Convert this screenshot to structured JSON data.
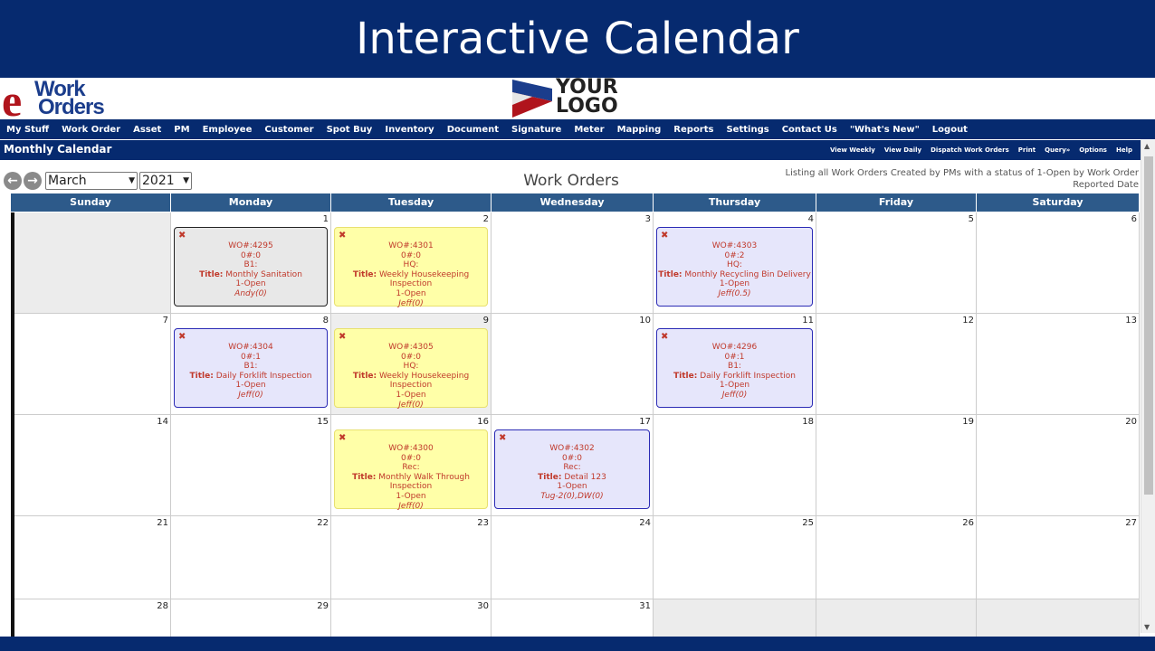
{
  "banner": {
    "title": "Interactive Calendar"
  },
  "brand": {
    "e": "e",
    "work": "Work",
    "orders": "Orders"
  },
  "placeholder_logo": {
    "line1": "YOUR",
    "line2": "LOGO"
  },
  "menu": [
    "My Stuff",
    "Work Order",
    "Asset",
    "PM",
    "Employee",
    "Customer",
    "Spot Buy",
    "Inventory",
    "Document",
    "Signature",
    "Meter",
    "Mapping",
    "Reports",
    "Settings",
    "Contact Us",
    "\"What's New\"",
    "Logout"
  ],
  "subbar": {
    "title": "Monthly Calendar",
    "links": [
      "View Weekly",
      "View Daily",
      "Dispatch Work Orders",
      "Print",
      "Query»",
      "Options",
      "Help"
    ]
  },
  "nav": {
    "month": "March",
    "year": "2021",
    "prev_glyph": "←",
    "next_glyph": "→"
  },
  "calendar": {
    "title": "Work Orders",
    "listing_line1": "Listing all Work Orders Created by PMs with a status of 1-Open by Work Order",
    "listing_line2": "Reported Date",
    "days": [
      "Sunday",
      "Monday",
      "Tuesday",
      "Wednesday",
      "Thursday",
      "Friday",
      "Saturday"
    ],
    "weeks": [
      [
        "",
        "1",
        "2",
        "3",
        "4",
        "5",
        "6"
      ],
      [
        "7",
        "8",
        "9",
        "10",
        "11",
        "12",
        "13"
      ],
      [
        "14",
        "15",
        "16",
        "17",
        "18",
        "19",
        "20"
      ],
      [
        "21",
        "22",
        "23",
        "24",
        "25",
        "26",
        "27"
      ],
      [
        "28",
        "29",
        "30",
        "31",
        "",
        "",
        ""
      ]
    ],
    "work_orders": [
      {
        "week": 0,
        "day": 1,
        "style": "gray",
        "wo": "WO#:4295",
        "o": "0#:0",
        "loc": "B1:",
        "title_label": "Title:",
        "title": "Monthly Sanitation",
        "status": "1-Open",
        "assignee": "Andy(0)"
      },
      {
        "week": 0,
        "day": 2,
        "style": "yellow",
        "wo": "WO#:4301",
        "o": "0#:0",
        "loc": "HQ:",
        "title_label": "Title:",
        "title": "Weekly Housekeeping Inspection",
        "status": "1-Open",
        "assignee": "Jeff(0)"
      },
      {
        "week": 0,
        "day": 4,
        "style": "blue",
        "wo": "WO#:4303",
        "o": "0#:2",
        "loc": "HQ:",
        "title_label": "Title:",
        "title": "Monthly Recycling Bin Delivery",
        "status": "1-Open",
        "assignee": "Jeff(0.5)"
      },
      {
        "week": 1,
        "day": 1,
        "style": "blue",
        "wo": "WO#:4304",
        "o": "0#:1",
        "loc": "B1:",
        "title_label": "Title:",
        "title": "Daily Forklift Inspection",
        "status": "1-Open",
        "assignee": "Jeff(0)"
      },
      {
        "week": 1,
        "day": 2,
        "style": "yellow",
        "wo": "WO#:4305",
        "o": "0#:0",
        "loc": "HQ:",
        "title_label": "Title:",
        "title": "Weekly Housekeeping Inspection",
        "status": "1-Open",
        "assignee": "Jeff(0)"
      },
      {
        "week": 1,
        "day": 4,
        "style": "blue",
        "wo": "WO#:4296",
        "o": "0#:1",
        "loc": "B1:",
        "title_label": "Title:",
        "title": "Daily Forklift Inspection",
        "status": "1-Open",
        "assignee": "Jeff(0)"
      },
      {
        "week": 2,
        "day": 2,
        "style": "yellow",
        "wo": "WO#:4300",
        "o": "0#:0",
        "loc": "Rec:",
        "title_label": "Title:",
        "title": "Monthly Walk Through Inspection",
        "status": "1-Open",
        "assignee": "Jeff(0)"
      },
      {
        "week": 2,
        "day": 3,
        "style": "blue",
        "wo": "WO#:4302",
        "o": "0#:0",
        "loc": "Rec:",
        "title_label": "Title:",
        "title": "Detail 123",
        "status": "1-Open",
        "assignee": "Tug-2(0),DW(0)"
      }
    ]
  },
  "colors": {
    "navy": "#062a6f",
    "header_blue": "#2d5a8a",
    "wo_text": "#c0392b"
  }
}
